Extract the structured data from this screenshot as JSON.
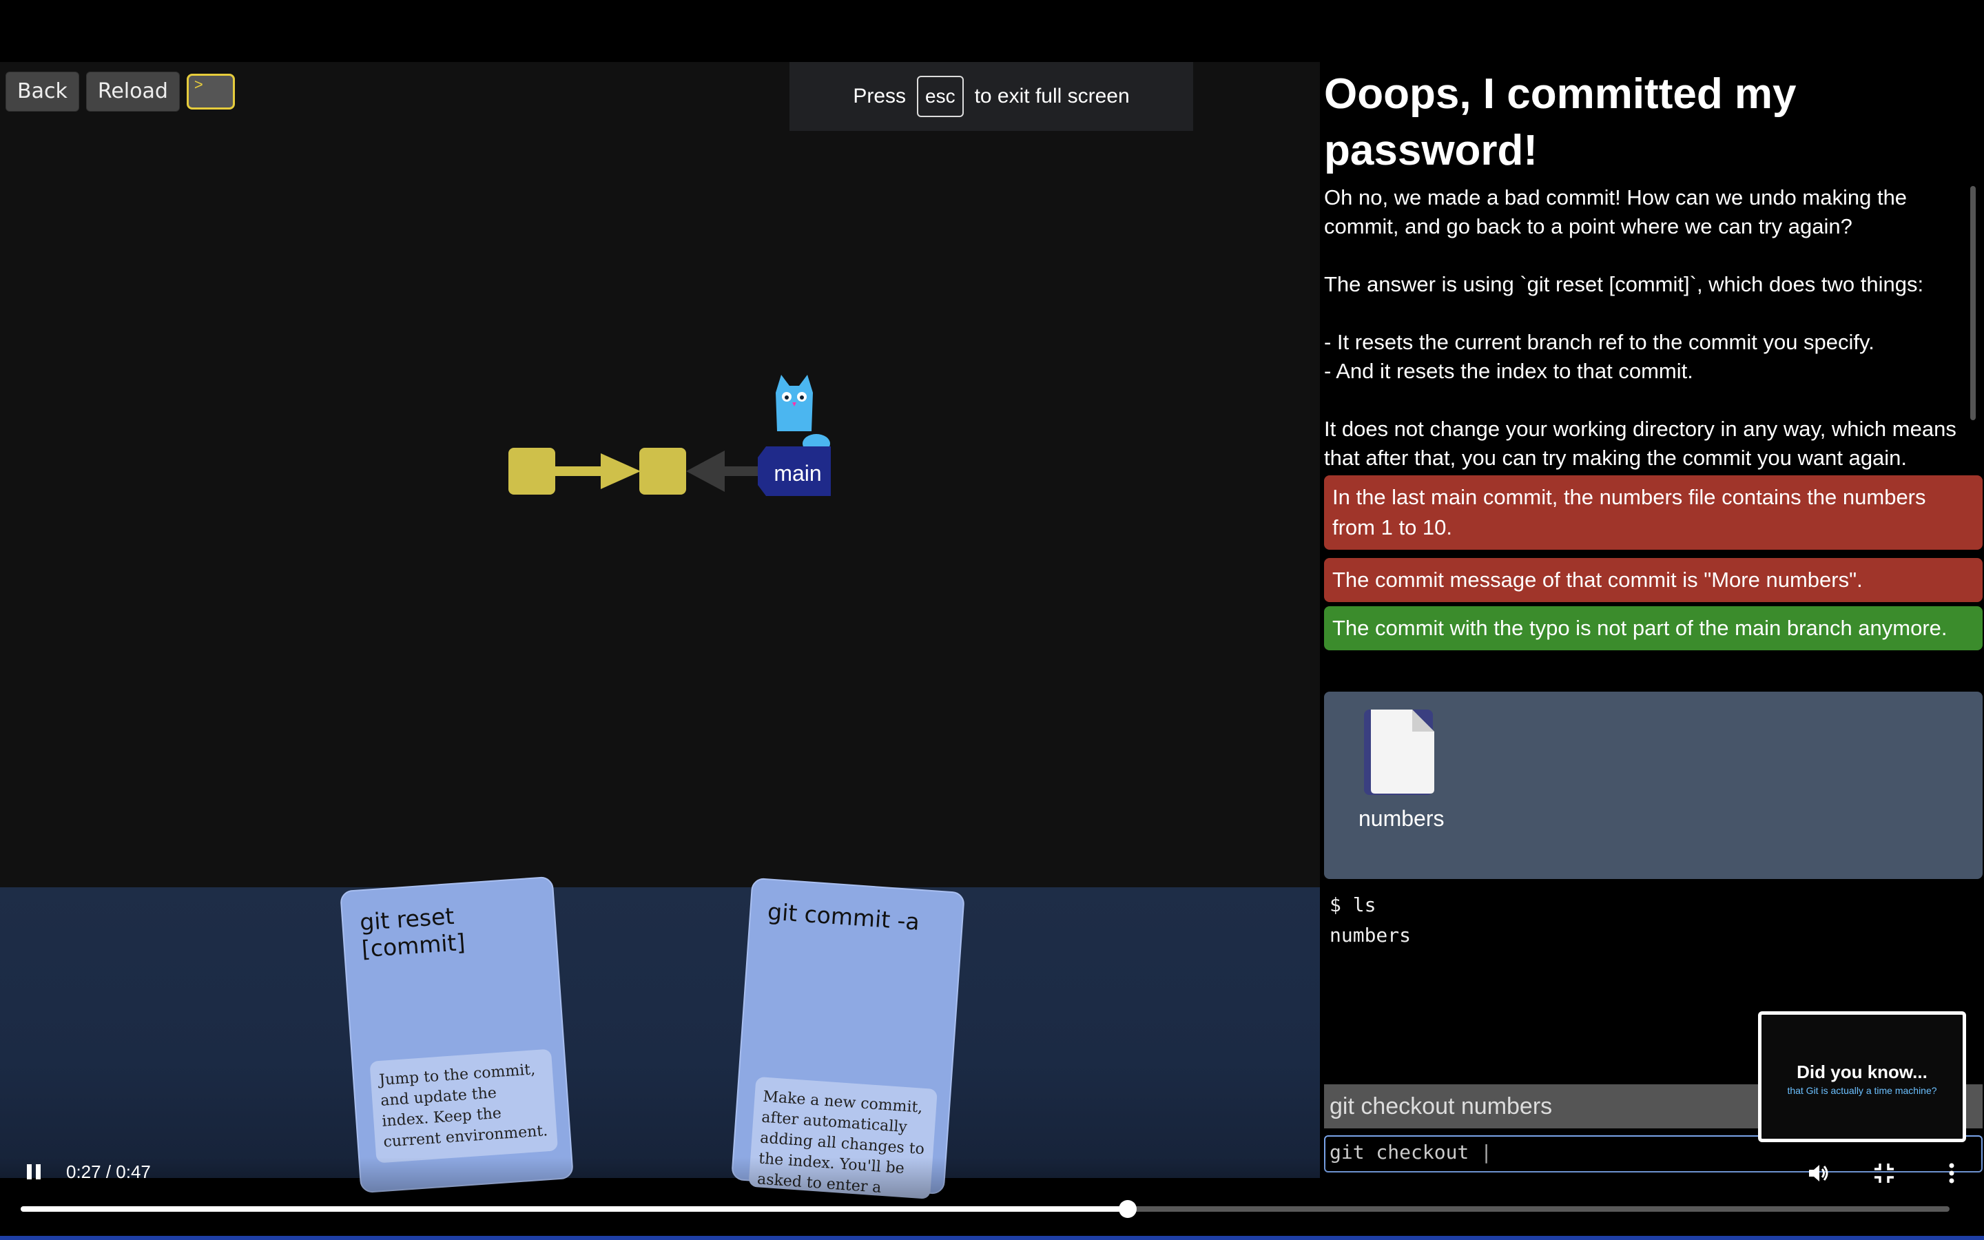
{
  "toolbar": {
    "back_label": "Back",
    "reload_label": "Reload",
    "terminal_symbol": ">"
  },
  "fullscreen_notice": {
    "prefix": "Press",
    "key": "esc",
    "suffix": "to exit full screen"
  },
  "graph": {
    "branch_label": "main",
    "commit_color": "#cfc04a",
    "branch_color": "#1f2a8a",
    "mascot_color": "#4bb6f0"
  },
  "cards": [
    {
      "title": "git reset [commit]",
      "description": "Jump to the commit, and update the index. Keep the current environment."
    },
    {
      "title": "git commit -a",
      "description": "Make a new commit, after automatically adding all changes to the index. You'll be asked to enter a short description of..."
    }
  ],
  "level": {
    "title": "Ooops, I committed my password!",
    "description": "Oh no, we made a bad commit! How can we undo making the commit, and go back to a point where we can try again?\n\nThe answer is using `git reset [commit]`, which does two things:\n\n- It resets the current branch ref to the commit you specify.\n- And it resets the index to that commit.\n\nIt does not change your working directory in any way, which means that after that, you can try making the commit you want again."
  },
  "goals": [
    {
      "text": "In the last main commit, the numbers file contains the numbers from 1 to 10.",
      "status": "failed",
      "color": "#a0352a"
    },
    {
      "text": "The commit message of that commit is \"More numbers\".",
      "status": "failed",
      "color": "#a0352a"
    },
    {
      "text": "The commit with the typo is not part of the main branch anymore.",
      "status": "passed",
      "color": "#3b8c2c"
    }
  ],
  "files": [
    {
      "name": "numbers",
      "icon": "file-icon"
    }
  ],
  "terminal": {
    "lines": [
      "$ ls",
      "numbers"
    ]
  },
  "suggestion": "git checkout numbers",
  "command_input": {
    "value": "git checkout "
  },
  "pip": {
    "title": "Did you know...",
    "subtitle": "that Git is actually a time machine?"
  },
  "video": {
    "time": "0:27 / 0:47",
    "progress": 0.574
  }
}
